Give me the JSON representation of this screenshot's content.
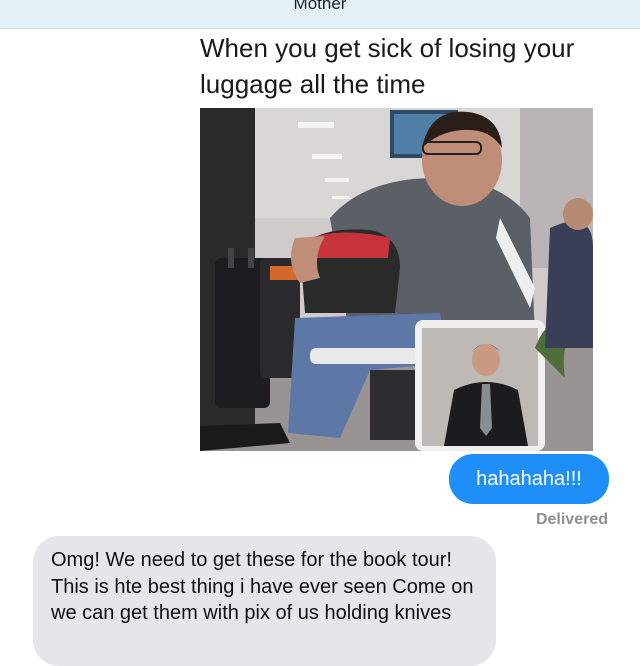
{
  "header": {
    "contact_name": "Mother"
  },
  "thread": {
    "image_caption": "When you get sick of losing your luggage all the time",
    "sent_message": "hahahaha!!!",
    "sent_status": "Delivered",
    "received_message": "Omg! We need to get these for the book tour! This is hte best thing i have ever seen Come on we can get them with pix of us holding knives"
  },
  "colors": {
    "sent_bubble": "#1e8ef9",
    "received_bubble": "#e5e5ea",
    "header_bg": "#e4f2f8"
  }
}
